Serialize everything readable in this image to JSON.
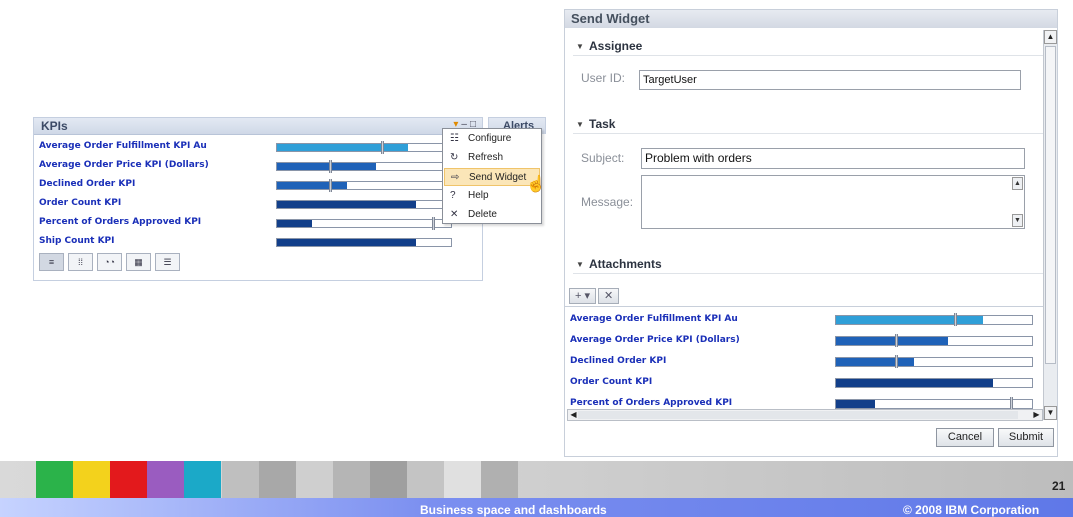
{
  "kpi_widget": {
    "title": "KPIs",
    "rows": [
      {
        "label": "Average Order Fulfillment KPI Au",
        "fill": 0.75,
        "color": "#2f9fd8",
        "marker": 0.6
      },
      {
        "label": "Average Order Price KPI (Dollars)",
        "fill": 0.57,
        "color": "#1f62b8",
        "marker": 0.3
      },
      {
        "label": "Declined Order KPI",
        "fill": 0.4,
        "color": "#1f62b8",
        "marker": 0.3
      },
      {
        "label": "Order Count KPI",
        "fill": 0.8,
        "color": "#123f8a",
        "marker": null
      },
      {
        "label": "Percent of Orders Approved KPI",
        "fill": 0.2,
        "color": "#123f8a",
        "marker": 0.89
      },
      {
        "label": "Ship Count KPI",
        "fill": 0.8,
        "color": "#123f8a",
        "marker": null
      }
    ],
    "view_buttons": [
      "list-view-icon",
      "group-view-icon",
      "gauge-view-icon",
      "table-view-icon",
      "detail-view-icon"
    ]
  },
  "alerts_tab": {
    "label": "Alerts"
  },
  "context_menu": {
    "items": [
      {
        "label": "Configure",
        "icon": "configure-icon",
        "glyph": "☷"
      },
      {
        "label": "Refresh",
        "icon": "refresh-icon",
        "glyph": "↻"
      },
      {
        "label": "Send Widget",
        "icon": "send-widget-icon",
        "glyph": "⇨"
      },
      {
        "label": "Help",
        "icon": "help-icon",
        "glyph": "?"
      },
      {
        "label": "Delete",
        "icon": "delete-icon",
        "glyph": "✕"
      }
    ]
  },
  "send_widget": {
    "title": "Send Widget",
    "assignee": {
      "section": "Assignee",
      "user_id_label": "User ID:",
      "user_id_value": "TargetUser"
    },
    "task": {
      "section": "Task",
      "subject_label": "Subject:",
      "subject_value": "Problem with orders",
      "message_label": "Message:",
      "message_value": ""
    },
    "attachments": {
      "section": "Attachments",
      "add_label": "+ ▾",
      "remove_label": "✕",
      "rows": [
        {
          "label": "Average Order Fulfillment KPI Au",
          "fill": 0.75,
          "color": "#2f9fd8",
          "marker": 0.6
        },
        {
          "label": "Average Order Price KPI (Dollars)",
          "fill": 0.57,
          "color": "#1f62b8",
          "marker": 0.3
        },
        {
          "label": "Declined Order KPI",
          "fill": 0.4,
          "color": "#1f62b8",
          "marker": 0.3
        },
        {
          "label": "Order Count KPI",
          "fill": 0.8,
          "color": "#123f8a",
          "marker": null
        },
        {
          "label": "Percent of Orders Approved KPI",
          "fill": 0.2,
          "color": "#123f8a",
          "marker": 0.89
        }
      ]
    },
    "cancel_label": "Cancel",
    "submit_label": "Submit"
  },
  "footer": {
    "title": "Business space and dashboards",
    "copyright": "© 2008 IBM Corporation",
    "page_number": "21",
    "squares": [
      "#2bb34a",
      "#f3d21c",
      "#e3191c",
      "#9a5cc0",
      "#1ba9c8"
    ]
  }
}
